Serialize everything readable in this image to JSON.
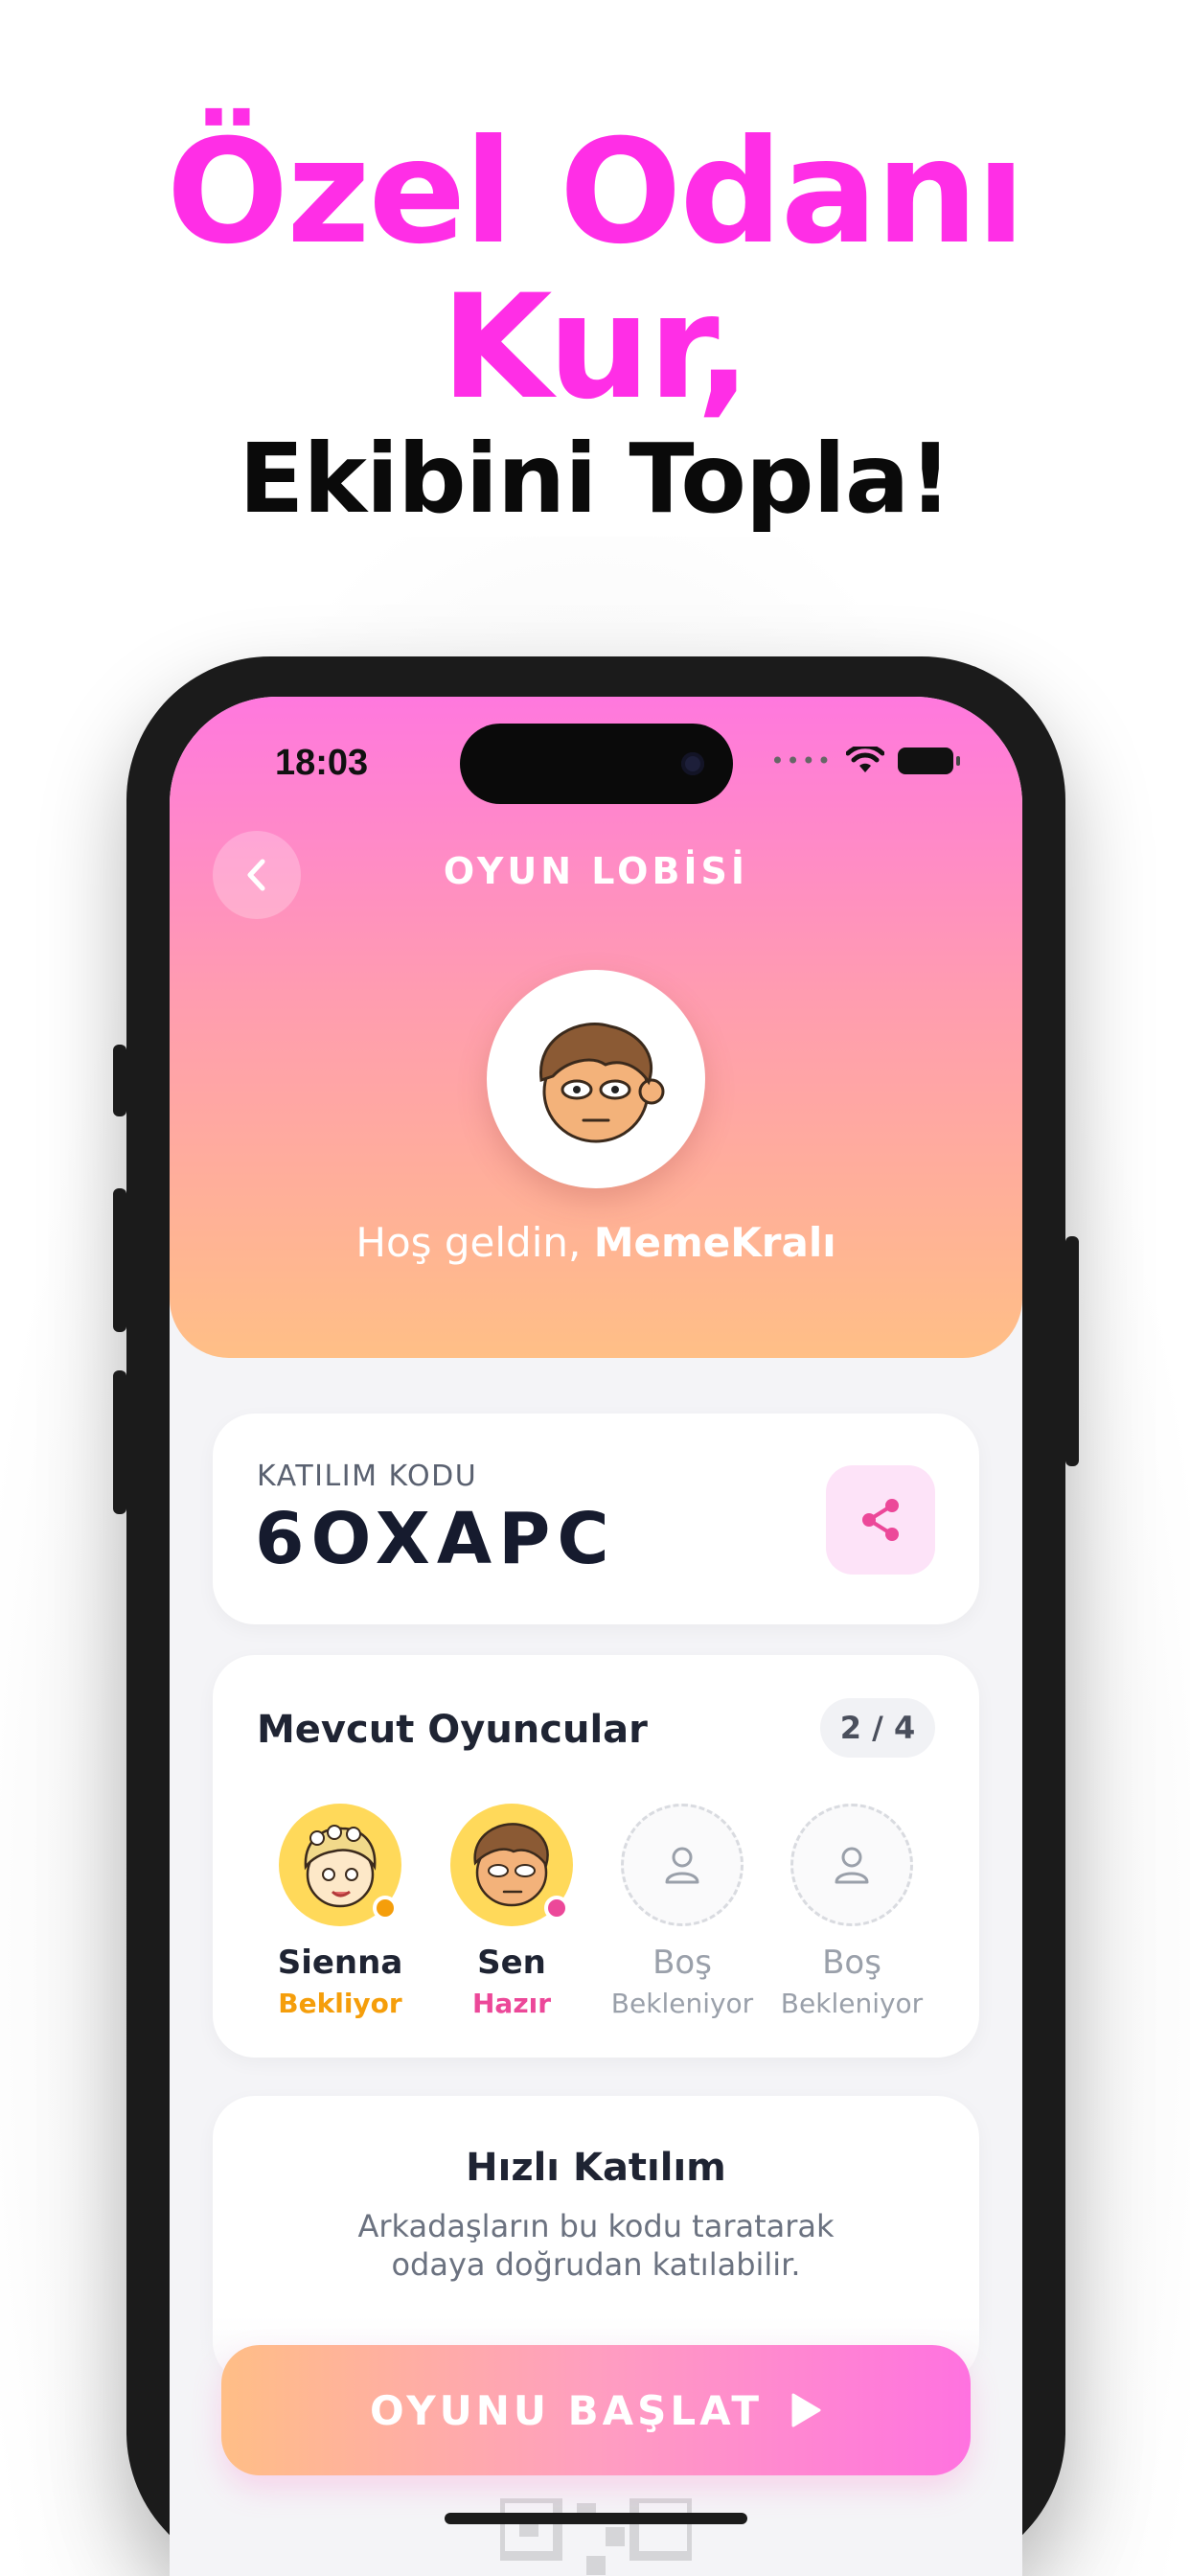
{
  "marketing": {
    "headline_line1": "Özel Odanı",
    "headline_line2": "Kur,",
    "subheadline": "Ekibini Topla!",
    "headline_color": "#ff2ee6"
  },
  "status_bar": {
    "time": "18:03",
    "icons": [
      "cellular-dots-icon",
      "wifi-icon",
      "battery-icon"
    ]
  },
  "header": {
    "title": "OYUN LOBİSİ",
    "back_icon": "chevron-left-icon",
    "welcome_prefix": "Hoş geldin,",
    "username": "MemeKralı"
  },
  "join_code": {
    "label": "KATILIM KODU",
    "code": "6OXAPC",
    "share_icon": "share-icon"
  },
  "players": {
    "title": "Mevcut Oyuncular",
    "count": "2 / 4",
    "slots": [
      {
        "name": "Sienna",
        "status": "Bekliyor",
        "status_color": "#f59e0b",
        "filled": true
      },
      {
        "name": "Sen",
        "status": "Hazır",
        "status_color": "#ec4899",
        "filled": true
      },
      {
        "name": "Boş",
        "status": "Bekleniyor",
        "status_color": "#9aa0aa",
        "filled": false
      },
      {
        "name": "Boş",
        "status": "Bekleniyor",
        "status_color": "#9aa0aa",
        "filled": false
      }
    ]
  },
  "quick_join": {
    "title": "Hızlı Katılım",
    "description": "Arkadaşların bu kodu taratarak odaya doğrudan katılabilir."
  },
  "start_button": {
    "label": "OYUNU BAŞLAT",
    "icon": "play-icon"
  }
}
